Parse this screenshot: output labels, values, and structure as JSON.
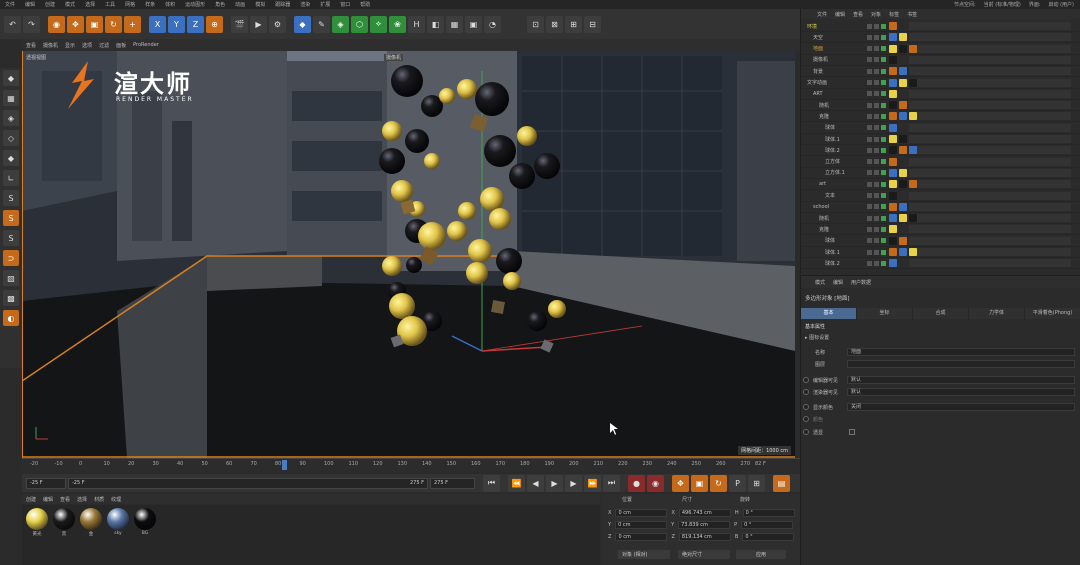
{
  "menubar": {
    "items": [
      "文件",
      "编辑",
      "创建",
      "模式",
      "选择",
      "工具",
      "网格",
      "样条",
      "体积",
      "运动图形",
      "角色",
      "动画",
      "模拟",
      "跟踪器",
      "渲染",
      "扩展",
      "窗口",
      "帮助"
    ],
    "node_space_label": "节点空间:",
    "node_space_value": "当前 (标准/物理)",
    "layout_label": "界面:",
    "layout_value": "启动 (用户)"
  },
  "toolbar": {
    "buttons": [
      "undo-icon",
      "redo-icon",
      "live-select-icon",
      "move-icon",
      "scale-icon",
      "rotate-icon",
      "create-icon",
      "x-axis-icon",
      "y-axis-icon",
      "z-axis-icon",
      "coordinate-system-icon",
      "render-view-icon",
      "render-picture-queue-icon",
      "render-settings-icon",
      "cube-icon",
      "pen-icon",
      "subdivision-icon",
      "cloner-icon",
      "deformer-icon",
      "field-icon",
      "tracker-icon",
      "scene-icon",
      "floor-icon",
      "camera-icon",
      "light-icon"
    ],
    "axis_x": "X",
    "axis_y": "Y",
    "axis_z": "Z",
    "right_icons": [
      "snap-icon",
      "workplane-icon",
      "grid-icon",
      "viewport-solo-icon"
    ]
  },
  "viewport": {
    "menu": [
      "查看",
      "摄像机",
      "显示",
      "选项",
      "过滤",
      "面板",
      "ProRender"
    ],
    "view_name": "透视视图",
    "camera_label": "摄像机",
    "grid_spacing": "网格间距：1000 cm",
    "logo_title": "渲大师",
    "logo_subtitle": "RENDER MASTER"
  },
  "timeline": {
    "ticks": [
      "-20",
      "-10",
      "0",
      "10",
      "20",
      "30",
      "40",
      "50",
      "60",
      "70",
      "80",
      "90",
      "100",
      "110",
      "120",
      "130",
      "140",
      "150",
      "160",
      "170",
      "180",
      "190",
      "200",
      "210",
      "220",
      "230",
      "240",
      "250",
      "260",
      "270"
    ],
    "current_frame": "82 F",
    "current_frame_value": 82
  },
  "playbar": {
    "start": "-25 F",
    "preview_start": "-25 F",
    "preview_end": "275 F",
    "end": "275 F"
  },
  "materials": {
    "menu": [
      "创建",
      "编辑",
      "查看",
      "选择",
      "材质",
      "纹理"
    ],
    "items": [
      {
        "name": "黄光",
        "color": "#e8d24a"
      },
      {
        "name": "黑",
        "color": "#1a1a1a"
      },
      {
        "name": "金",
        "color": "#9a7a3a"
      },
      {
        "name": "sky",
        "color": "#5a78a8"
      },
      {
        "name": "BG",
        "color": "#0d0d10"
      }
    ]
  },
  "coords": {
    "headers": {
      "position": "位置",
      "size": "尺寸",
      "rotation": "旋转"
    },
    "rows": [
      {
        "axis": "X",
        "pos": "0 cm",
        "size_axis": "X",
        "size": "496.743 cm",
        "rot_axis": "H",
        "rot": "0 °"
      },
      {
        "axis": "Y",
        "pos": "0 cm",
        "size_axis": "Y",
        "size": "73.839 cm",
        "rot_axis": "P",
        "rot": "0 °"
      },
      {
        "axis": "Z",
        "pos": "0 cm",
        "size_axis": "Z",
        "size": "819.134 cm",
        "rot_axis": "B",
        "rot": "0 °"
      }
    ],
    "object_mode": "对象 (相对)",
    "size_mode": "绝对尺寸",
    "apply": "应用"
  },
  "object_manager": {
    "menu": [
      "文件",
      "编辑",
      "查看",
      "对象",
      "标签",
      "书签"
    ],
    "objects": [
      {
        "name": "环境",
        "indent": 0,
        "color": "#d9d24a"
      },
      {
        "name": "天空",
        "indent": 1,
        "color": "#bbb"
      },
      {
        "name": "地面",
        "indent": 1,
        "color": "#d9a24a"
      },
      {
        "name": "摄像机",
        "indent": 1,
        "color": "#bbb"
      },
      {
        "name": "背景",
        "indent": 1,
        "color": "#bbb"
      },
      {
        "name": "文字动画",
        "indent": 0,
        "color": "#bbb"
      },
      {
        "name": "ART",
        "indent": 1,
        "color": "#bbb"
      },
      {
        "name": "随机",
        "indent": 2,
        "color": "#bbb"
      },
      {
        "name": "克隆",
        "indent": 2,
        "color": "#bbb"
      },
      {
        "name": "球体",
        "indent": 3,
        "color": "#bbb"
      },
      {
        "name": "球体.1",
        "indent": 3,
        "color": "#bbb"
      },
      {
        "name": "球体.2",
        "indent": 3,
        "color": "#bbb"
      },
      {
        "name": "立方体",
        "indent": 3,
        "color": "#bbb"
      },
      {
        "name": "立方体.1",
        "indent": 3,
        "color": "#bbb"
      },
      {
        "name": "art",
        "indent": 2,
        "color": "#bbb"
      },
      {
        "name": "文本",
        "indent": 3,
        "color": "#bbb"
      },
      {
        "name": "school",
        "indent": 1,
        "color": "#bbb"
      },
      {
        "name": "随机",
        "indent": 2,
        "color": "#bbb"
      },
      {
        "name": "克隆",
        "indent": 2,
        "color": "#bbb"
      },
      {
        "name": "球体",
        "indent": 3,
        "color": "#bbb"
      },
      {
        "name": "球体.1",
        "indent": 3,
        "color": "#bbb"
      },
      {
        "name": "球体.2",
        "indent": 3,
        "color": "#bbb"
      }
    ]
  },
  "attribute_manager": {
    "menu": [
      "模式",
      "编辑",
      "用户数据"
    ],
    "object_title": "多边形对象 [地面]",
    "tabs": [
      "基本",
      "坐标",
      "合成",
      "力学体",
      "平滑着色(Phong)"
    ],
    "active_tab": "基本",
    "section": "基本属性",
    "subsection": "▸ 图标设置",
    "name_label": "名称",
    "name_value": "地面",
    "layer_label": "图层",
    "editor_visible_label": "编辑器可见",
    "editor_visible_value": "默认",
    "render_visible_label": "渲染器可见",
    "render_visible_value": "默认",
    "display_color_label": "显示颜色",
    "display_color_value": "关闭",
    "color_label": "颜色",
    "transparent_label": "透显"
  }
}
